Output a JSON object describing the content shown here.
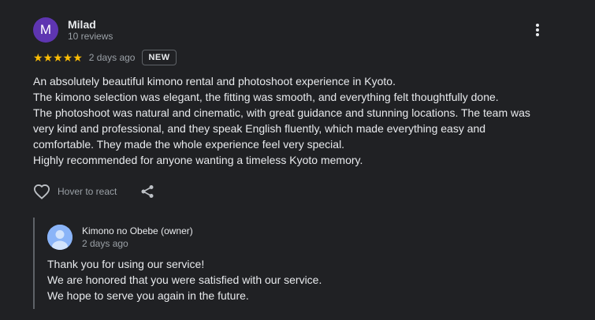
{
  "review": {
    "avatar_letter": "M",
    "author": "Milad",
    "author_meta": "10 reviews",
    "stars": "★★★★★",
    "rating": 5,
    "date": "2 days ago",
    "badge": "NEW",
    "text_lines": [
      "An absolutely beautiful kimono rental and photoshoot experience in Kyoto.",
      "The kimono selection was elegant, the fitting was smooth, and everything felt thoughtfully done.",
      "The photoshoot was natural and cinematic, with great guidance and stunning locations. The team was",
      "very kind and professional, and they speak English fluently, which made everything easy and",
      "comfortable. They made the whole experience feel very special.",
      "Highly recommended for anyone wanting a timeless Kyoto memory."
    ],
    "react_label": "Hover to react"
  },
  "owner_reply": {
    "name": "Kimono no Obebe (owner)",
    "date": "2 days ago",
    "text_lines": [
      "Thank you for using our service!",
      "We are honored that you were satisfied with our service.",
      "We hope to serve you again in the future."
    ]
  },
  "colors": {
    "background": "#202124",
    "star": "#fbbc04",
    "avatar": "#5e35b1",
    "owner_avatar": "#8ab4f8"
  },
  "icons": [
    "more-vert-icon",
    "heart-outline-icon",
    "share-icon",
    "person-icon"
  ]
}
